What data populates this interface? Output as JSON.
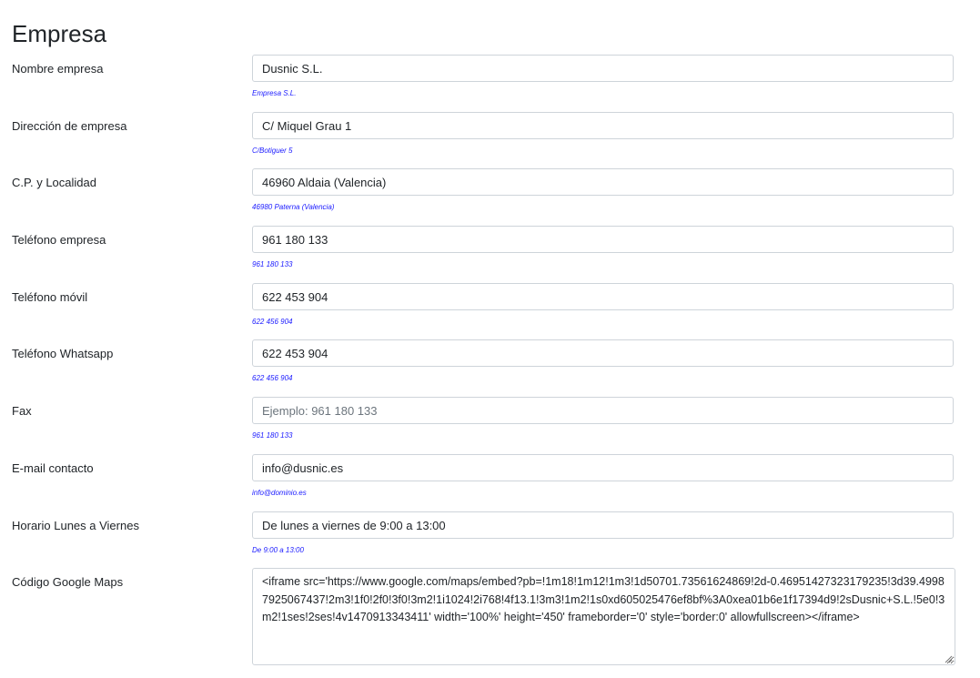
{
  "section": {
    "title": "Empresa"
  },
  "fields": [
    {
      "label": "Nombre empresa",
      "value": "Dusnic S.L.",
      "placeholder": "",
      "hint": "Empresa S.L."
    },
    {
      "label": "Dirección de empresa",
      "value": "C/ Miquel Grau 1",
      "placeholder": "",
      "hint": "C/Botiguer 5"
    },
    {
      "label": "C.P. y Localidad",
      "value": "46960 Aldaia (Valencia)",
      "placeholder": "",
      "hint": "46980 Paterna (Valencia)"
    },
    {
      "label": "Teléfono empresa",
      "value": "961 180 133",
      "placeholder": "",
      "hint": "961 180 133"
    },
    {
      "label": "Teléfono móvil",
      "value": "622 453 904",
      "placeholder": "",
      "hint": "622 456 904"
    },
    {
      "label": "Teléfono Whatsapp",
      "value": "622 453 904",
      "placeholder": "",
      "hint": "622 456 904"
    },
    {
      "label": "Fax",
      "value": "",
      "placeholder": "Ejemplo: 961 180 133",
      "hint": "961 180 133"
    },
    {
      "label": "E-mail contacto",
      "value": "info@dusnic.es",
      "placeholder": "",
      "hint": "info@dominio.es"
    },
    {
      "label": "Horario Lunes a Viernes",
      "value": "De lunes a viernes de 9:00 a 13:00",
      "placeholder": "",
      "hint": "De 9:00 a 13:00"
    }
  ],
  "maps": {
    "label": "Código Google Maps",
    "value": "<iframe src='https://www.google.com/maps/embed?pb=!1m18!1m12!1m3!1d50701.73561624869!2d-0.46951427323179235!3d39.49987925067437!2m3!1f0!2f0!3f0!3m2!1i1024!2i768!4f13.1!3m3!1m2!1s0xd605025476ef8bf%3A0xea01b6e1f17394d9!2sDusnic+S.L.!5e0!3m2!1ses!2ses!4v1470913343411' width='100%' height='450' frameborder='0' style='border:0' allowfullscreen></iframe>"
  },
  "colors": {
    "hint": "#1a1aff",
    "border": "#ced4da",
    "text": "#212529"
  }
}
